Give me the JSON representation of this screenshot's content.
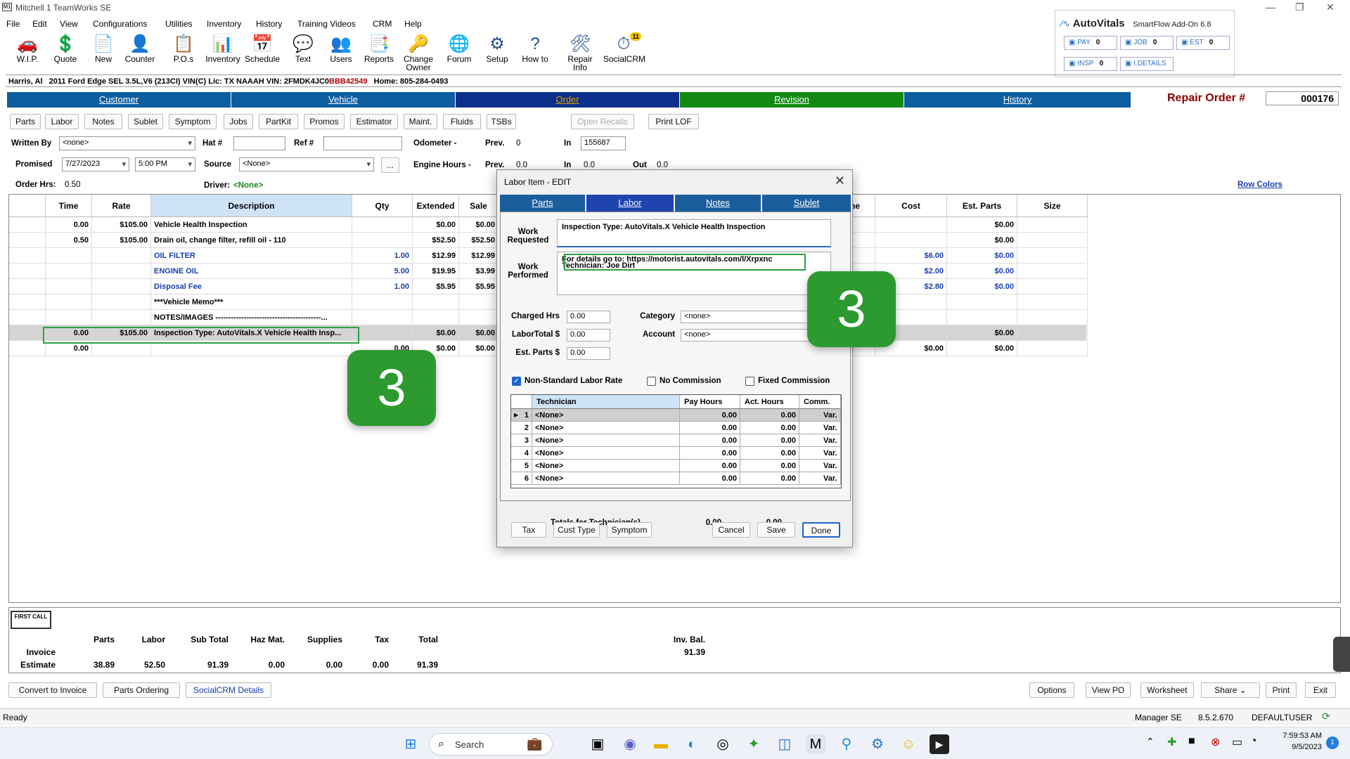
{
  "window": {
    "title": "Mitchell 1 TeamWorks SE",
    "logo": "M1"
  },
  "menu": [
    "File",
    "Edit",
    "View",
    "Configurations",
    "Utilities",
    "Inventory",
    "History",
    "Training Videos",
    "CRM",
    "Help"
  ],
  "toolbar": [
    {
      "label": "W.I.P.",
      "icon": "wip-icon",
      "glyph": "🚗"
    },
    {
      "label": "Quote",
      "icon": "quote-icon",
      "glyph": "💲"
    },
    {
      "label": "New",
      "icon": "new-icon",
      "glyph": "📄"
    },
    {
      "label": "Counter",
      "icon": "counter-icon",
      "glyph": "👤"
    },
    {
      "label": "P.O.s",
      "icon": "po-icon",
      "glyph": "📋"
    },
    {
      "label": "Inventory",
      "icon": "inventory-icon",
      "glyph": "📊"
    },
    {
      "label": "Schedule",
      "icon": "schedule-icon",
      "glyph": "📅"
    },
    {
      "label": "Text",
      "icon": "text-icon",
      "glyph": "💬"
    },
    {
      "label": "Users",
      "icon": "users-icon",
      "glyph": "👥"
    },
    {
      "label": "Reports",
      "icon": "reports-icon",
      "glyph": "📑"
    },
    {
      "label": "Change\nOwner",
      "icon": "change-owner-icon",
      "glyph": "🔑"
    },
    {
      "label": "Forum",
      "icon": "forum-icon",
      "glyph": "🌐"
    },
    {
      "label": "Setup",
      "icon": "setup-icon",
      "glyph": "⚙"
    },
    {
      "label": "How to",
      "icon": "howto-icon",
      "glyph": "?"
    },
    {
      "label": "Repair Info",
      "icon": "repair-info-icon",
      "glyph": "🛠"
    },
    {
      "label": "SocialCRM",
      "icon": "socialcrm-icon",
      "glyph": "⏱",
      "badge": "11"
    }
  ],
  "autovitals": {
    "brand": "AutoVitals",
    "subtitle": "SmartFlow Add-On 6.8",
    "buttons": [
      {
        "label": "PAY",
        "count": "0"
      },
      {
        "label": "JOB",
        "count": "0"
      },
      {
        "label": "EST",
        "count": "0"
      },
      {
        "label": "INSP",
        "count": "0"
      },
      {
        "label": "I.DETAILS",
        "count": ""
      }
    ]
  },
  "customer_line": {
    "name": "Harris, Al",
    "vehicle": "2011  Ford Edge SEL  3.5L,V6 (213CI) VIN(C) Lic: TX NAAAH  VIN: 2FMDK4JC0",
    "vin_tail": "BBB42549",
    "phone": "Home: 805-284-0493"
  },
  "tabs": [
    {
      "label": "Customer",
      "color": "#0d5ea0"
    },
    {
      "label": "Vehicle",
      "color": "#0d5ea0"
    },
    {
      "label": "Order",
      "color": "#0b2f8a",
      "text_color": "#e0a000"
    },
    {
      "label": "Revision",
      "color": "#128a12"
    },
    {
      "label": "History",
      "color": "#0d5ea0"
    }
  ],
  "repair_order": {
    "label": "Repair Order #",
    "number": "000176"
  },
  "subtabs": [
    "Parts",
    "Labor",
    "Notes",
    "Sublet",
    "Symptom",
    "Jobs",
    "PartKit",
    "Promos",
    "Estimator",
    "Maint.",
    "Fluids",
    "TSBs"
  ],
  "open_recalls": "Open Recalls",
  "print_lof": "Print LOF",
  "form": {
    "written_by_label": "Written By",
    "written_by": "<none>",
    "hat_label": "Hat #",
    "ref_label": "Ref #",
    "odometer_label": "Odometer -",
    "prev_label": "Prev.",
    "odo_prev": "0",
    "in_label": "In",
    "odo_in": "155687",
    "promised_label": "Promised",
    "promised_date": "7/27/2023",
    "promised_time": "5:00 PM",
    "source_label": "Source",
    "source": "<None>",
    "ellipsis": "...",
    "engine_label": "Engine Hours -",
    "eng_prev": "0.0",
    "eng_in": "0.0",
    "out_label": "Out",
    "eng_out": "0.0",
    "order_hrs_label": "Order Hrs:",
    "order_hrs": "0.50",
    "driver_label": "Driver:",
    "driver": "<None>",
    "row_colors": "Row Colors"
  },
  "grid": {
    "headers": [
      "Time",
      "Rate",
      "Description",
      "Qty",
      "Extended",
      "Sale",
      "ne",
      "Cost",
      "Est. Parts",
      "Size"
    ],
    "rows": [
      {
        "time": "0.00",
        "rate": "$105.00",
        "desc": "Vehicle Health Inspection",
        "qty": "",
        "ext": "$0.00",
        "sale": "$0.00",
        "cost": "",
        "est": "$0.00",
        "style": "bld"
      },
      {
        "time": "0.50",
        "rate": "$105.00",
        "desc": "Drain oil, change filter, refill oil - 110",
        "qty": "",
        "ext": "$52.50",
        "sale": "$52.50",
        "cost": "",
        "est": "$0.00",
        "style": "bld"
      },
      {
        "time": "",
        "rate": "",
        "desc": "OIL FILTER",
        "qty": "1.00",
        "ext": "$12.99",
        "sale": "$12.99",
        "cost": "$6.00",
        "est": "$0.00",
        "style": "blue"
      },
      {
        "time": "",
        "rate": "",
        "desc": "ENGINE OIL",
        "qty": "5.00",
        "ext": "$19.95",
        "sale": "$3.99",
        "cost": "$2.00",
        "est": "$0.00",
        "style": "blue"
      },
      {
        "time": "",
        "rate": "",
        "desc": "Disposal Fee",
        "qty": "1.00",
        "ext": "$5.95",
        "sale": "$5.95",
        "cost": "$2.80",
        "est": "$0.00",
        "style": "blue"
      },
      {
        "time": "",
        "rate": "",
        "desc": "***Vehicle Memo***",
        "qty": "",
        "ext": "",
        "sale": "",
        "cost": "",
        "est": "",
        "style": "bld"
      },
      {
        "time": "",
        "rate": "",
        "desc": "NOTES/IMAGES  -----------------------------------------...",
        "qty": "",
        "ext": "",
        "sale": "",
        "cost": "",
        "est": "",
        "style": "bld"
      },
      {
        "time": "0.00",
        "rate": "$105.00",
        "desc": "Inspection Type: AutoVitals.X Vehicle Health Insp...",
        "qty": "",
        "ext": "$0.00",
        "sale": "$0.00",
        "cost": "",
        "est": "$0.00",
        "style": "sel"
      },
      {
        "time": "0.00",
        "rate": "",
        "desc": "",
        "qty": "0.00",
        "ext": "$0.00",
        "sale": "$0.00",
        "cost": "$0.00",
        "est": "$0.00",
        "style": "bld"
      }
    ]
  },
  "summary": {
    "logo": "FIRST CALL",
    "headers": [
      "Parts",
      "Labor",
      "Sub Total",
      "Haz Mat.",
      "Supplies",
      "Tax",
      "Total",
      "Inv. Bal."
    ],
    "invoice_label": "Invoice",
    "estimate_label": "Estimate",
    "invoice_balance": "91.39",
    "estimate": [
      "38.89",
      "52.50",
      "91.39",
      "0.00",
      "0.00",
      "0.00",
      "91.39"
    ]
  },
  "bottom_buttons": {
    "left": [
      "Convert to Invoice",
      "Parts Ordering",
      "SocialCRM Details"
    ],
    "right": [
      "Options",
      "View PO",
      "Worksheet",
      "Share",
      "Print",
      "Exit"
    ]
  },
  "dialog": {
    "title": "Labor Item - EDIT",
    "tabs": [
      "Parts",
      "Labor",
      "Notes",
      "Sublet"
    ],
    "work_requested_label": "Work\nRequested",
    "work_requested": "Inspection Type: AutoVitals.X Vehicle Health Inspection",
    "work_performed_label": "Work\nPerformed",
    "work_performed_line1": "For details go to: https://motorist.autovitals.com/l/Xrpxnc",
    "work_performed_line2": "Technician: Joe Dirt",
    "charged_hrs_label": "Charged Hrs",
    "charged_hrs": "0.00",
    "labor_total_label": "LaborTotal $",
    "labor_total": "0.00",
    "est_parts_label": "Est. Parts $",
    "est_parts": "0.00",
    "category_label": "Category",
    "category": "<none>",
    "account_label": "Account",
    "account": "<none>",
    "chk_nonstd": "Non-Standard Labor Rate",
    "chk_nocomm": "No Commission",
    "chk_fixed": "Fixed Commission",
    "tech_headers": [
      "Technician",
      "Pay Hours",
      "Act. Hours",
      "Comm."
    ],
    "tech_rows": [
      {
        "n": "1",
        "tech": "<None>",
        "pay": "0.00",
        "act": "0.00",
        "comm": "Var."
      },
      {
        "n": "2",
        "tech": "<None>",
        "pay": "0.00",
        "act": "0.00",
        "comm": "Var."
      },
      {
        "n": "3",
        "tech": "<None>",
        "pay": "0.00",
        "act": "0.00",
        "comm": "Var."
      },
      {
        "n": "4",
        "tech": "<None>",
        "pay": "0.00",
        "act": "0.00",
        "comm": "Var."
      },
      {
        "n": "5",
        "tech": "<None>",
        "pay": "0.00",
        "act": "0.00",
        "comm": "Var."
      },
      {
        "n": "6",
        "tech": "<None>",
        "pay": "0.00",
        "act": "0.00",
        "comm": "Var."
      }
    ],
    "totals_label": "Totals for Technician(s)",
    "totals_pay": "0.00",
    "totals_act": "0.00",
    "buttons_left": [
      "Tax",
      "Cust Type",
      "Symptom"
    ],
    "buttons_right": [
      "Cancel",
      "Save",
      "Done"
    ]
  },
  "badges": [
    "3",
    "3"
  ],
  "status": {
    "left": "Ready",
    "manager": "Manager SE",
    "version": "8.5.2.670",
    "user": "DEFAULTUSER"
  },
  "taskbar": {
    "search": "Search",
    "time": "7:59:53 AM",
    "date": "9/5/2023",
    "notif": "1"
  }
}
